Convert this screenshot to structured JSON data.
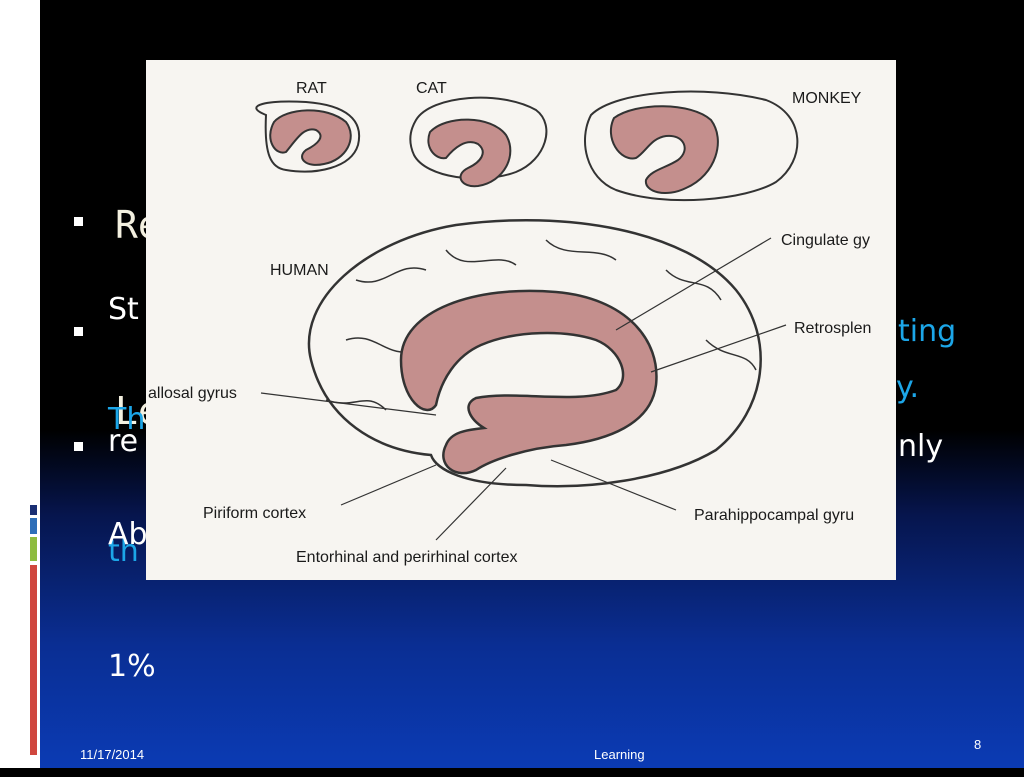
{
  "slide": {
    "title_lines": [
      "Re",
      "Le"
    ],
    "bullets": [
      {
        "line1": "St",
        "line2": "re"
      },
      {
        "line1": "Th",
        "line2": "th",
        "right1": "ting",
        "right2": "y."
      },
      {
        "line1": "Ab",
        "line2": "1%",
        "right1": "nly"
      }
    ]
  },
  "figure": {
    "species": [
      "RAT",
      "CAT",
      "MONKEY",
      "HUMAN"
    ],
    "labels": {
      "cingulate": "Cingulate gy",
      "retrosplenial": "Retrosplen",
      "callosal": "allosal gyrus",
      "piriform": "Piriform cortex",
      "parahippocampal": "Parahippocampal gyru",
      "entorhinal": "Entorhinal and perirhinal cortex"
    }
  },
  "footer": {
    "date": "11/17/2014",
    "center": "Learning",
    "page": "8"
  },
  "colors": {
    "limbic_fill": "#c48f8d",
    "accent_blue": "#1ca6e8"
  }
}
